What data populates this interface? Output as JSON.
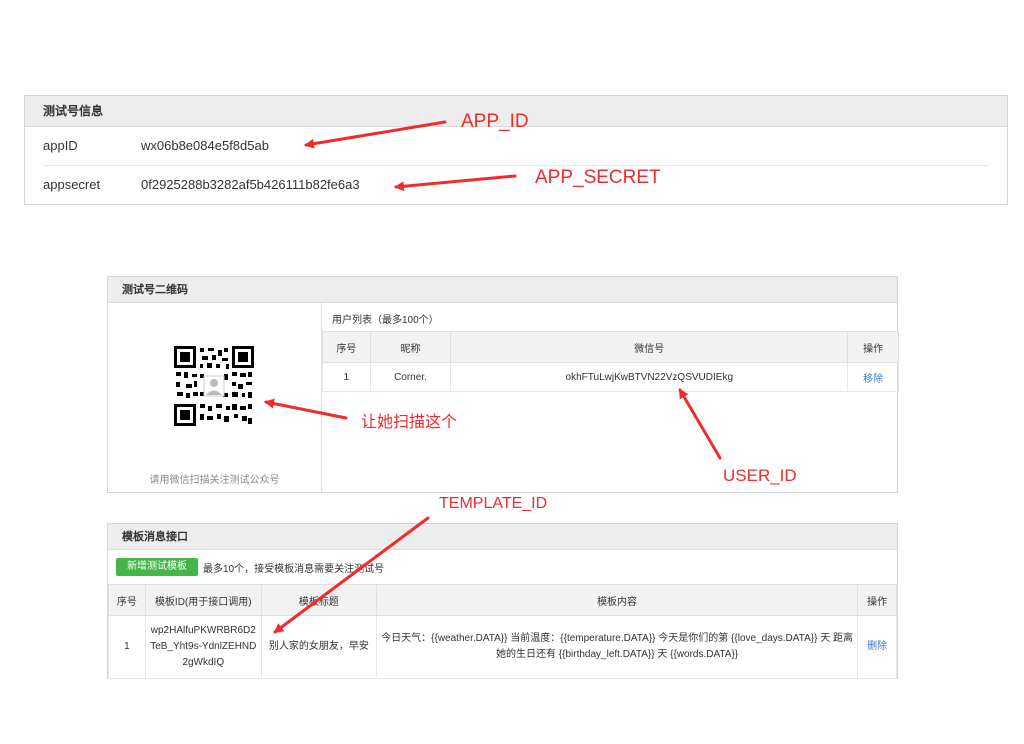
{
  "test_account": {
    "title": "测试号信息",
    "appid_label": "appID",
    "appid_value": "wx06b8e084e5f8d5ab",
    "secret_label": "appsecret",
    "secret_value": "0f2925288b3282af5b426111b82fe6a3"
  },
  "qr_panel": {
    "title": "测试号二维码",
    "qr_caption": "请用微信扫描关注测试公众号",
    "user_list_title": "用户列表（最多100个）",
    "columns": [
      "序号",
      "昵称",
      "微信号",
      "操作"
    ],
    "rows": [
      {
        "index": "1",
        "nickname": "Corner.",
        "wechat_id": "okhFTuLwjKwBTVN22VzQSVUDIEkg",
        "action": "移除"
      }
    ]
  },
  "template_panel": {
    "title": "模板消息接口",
    "add_button": "新增测试模板",
    "note": "最多10个，接受模板消息需要关注测试号",
    "columns": [
      "序号",
      "模板ID(用于接口调用)",
      "模板标题",
      "模板内容",
      "操作"
    ],
    "rows": [
      {
        "index": "1",
        "template_id": "wp2HAlfuPKWRBR6D2TeB_Yht9s-YdnlZEHND2gWkdIQ",
        "template_title": "别人家的女朋友，早安",
        "template_content": "今日天气：{{weather.DATA}} 当前温度：{{temperature.DATA}} 今天是你们的第 {{love_days.DATA}} 天 距离她的生日还有 {{birthday_left.DATA}} 天 {{words.DATA}}",
        "action": "删除"
      }
    ]
  },
  "annotations": {
    "app_id": "APP_ID",
    "app_secret": "APP_SECRET",
    "scan_hint": "让她扫描这个",
    "user_id": "USER_ID",
    "template_id": "TEMPLATE_ID",
    "color": "#f02b2b"
  },
  "colors": {
    "panel_header_bg": "#ededed",
    "button_green": "#44b549",
    "link_blue": "#3d7cc9"
  }
}
